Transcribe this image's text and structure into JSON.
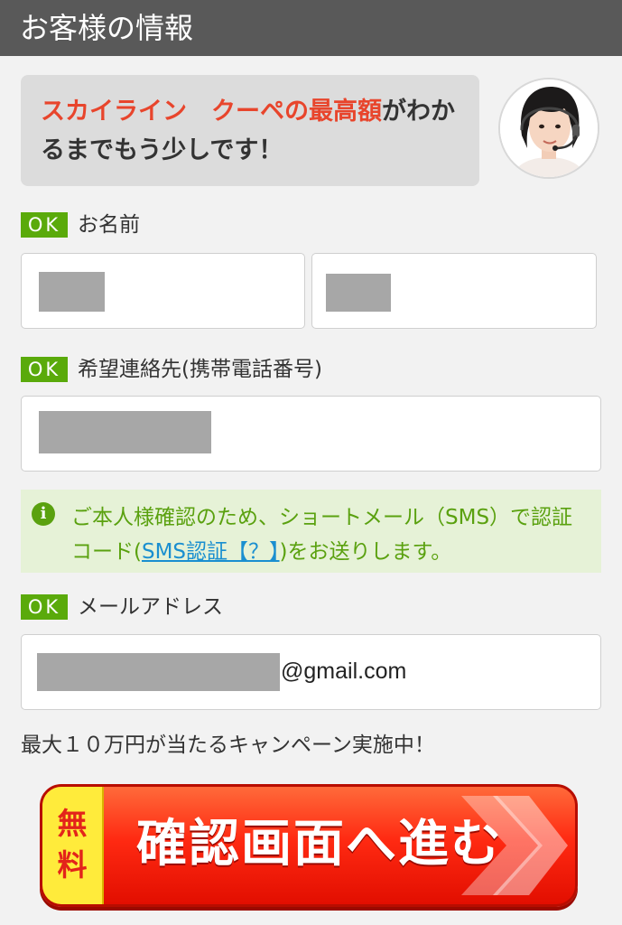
{
  "header": {
    "title": "お客様の情報"
  },
  "message": {
    "highlight": "スカイライン　クーペの最高額",
    "rest": "がわかるまでもう少しです！"
  },
  "form": {
    "name": {
      "badge": "OK",
      "label": "お名前"
    },
    "phone": {
      "badge": "OK",
      "label": "希望連絡先(携帯電話番号)"
    },
    "notice": {
      "before": "ご本人様確認のため、ショートメール（SMS）で認証コード(",
      "link": "SMS認証【？】",
      "after": ")をお送りします。"
    },
    "email": {
      "badge": "OK",
      "label": "メールアドレス",
      "suffix": "@gmail.com"
    }
  },
  "campaign": "最大１０万円が当たるキャンペーン実施中！",
  "cta": {
    "free": "無料",
    "label": "確認画面へ進む"
  },
  "colors": {
    "header": "#595959",
    "ok_badge": "#5aaa0b",
    "highlight": "#e8452c",
    "notice_bg": "#e6f2d7",
    "notice_text": "#5aa10f",
    "link": "#1a8fd0",
    "cta": "#ff2a12",
    "cta_free_bg": "#ffeb3b"
  },
  "icons": [
    "info-icon",
    "operator-avatar",
    "double-chevron-right-icon"
  ]
}
